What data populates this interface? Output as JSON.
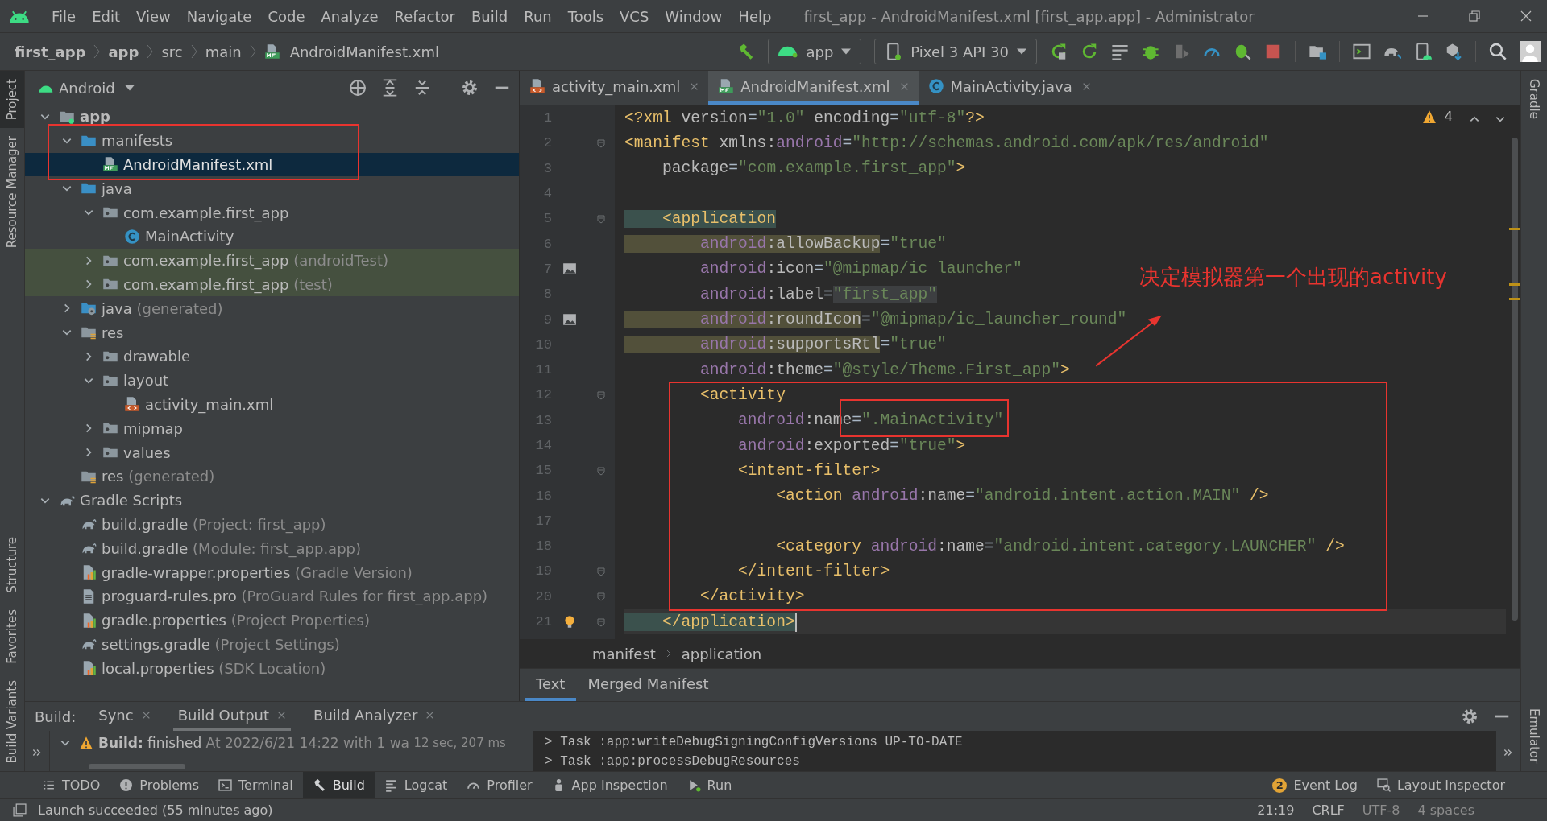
{
  "window": {
    "title": "first_app - AndroidManifest.xml [first_app.app] - Administrator"
  },
  "menu": [
    "File",
    "Edit",
    "View",
    "Navigate",
    "Code",
    "Analyze",
    "Refactor",
    "Build",
    "Run",
    "Tools",
    "VCS",
    "Window",
    "Help"
  ],
  "breadcrumb": [
    {
      "label": "first_app",
      "kind": "module"
    },
    {
      "label": "app",
      "kind": "module"
    },
    {
      "label": "src",
      "kind": "folder"
    },
    {
      "label": "main",
      "kind": "folder"
    },
    {
      "label": "AndroidManifest.xml",
      "kind": "manifest"
    }
  ],
  "run_config": {
    "module": "app",
    "device": "Pixel 3 API 30"
  },
  "left_tools": [
    {
      "label": "Project",
      "selected": true
    },
    {
      "label": "Resource Manager",
      "selected": false
    },
    {
      "label": "Structure",
      "selected": false
    },
    {
      "label": "Favorites",
      "selected": false
    },
    {
      "label": "Build Variants",
      "selected": false
    }
  ],
  "right_tools": [
    {
      "label": "Gradle",
      "selected": false
    },
    {
      "label": "Emulator",
      "selected": false
    }
  ],
  "project_panel": {
    "view": "Android",
    "tree": [
      {
        "label": "app",
        "kind": "module",
        "expanded": true,
        "selected": false,
        "tinted": false,
        "children": [
          {
            "label": "manifests",
            "kind": "folder",
            "expanded": true,
            "selected": false,
            "tinted": false,
            "children": [
              {
                "label": "AndroidManifest.xml",
                "kind": "manifest",
                "selected": true,
                "tinted": false
              }
            ]
          },
          {
            "label": "java",
            "kind": "folder",
            "expanded": true,
            "selected": false,
            "tinted": false,
            "children": [
              {
                "label": "com.example.first_app",
                "kind": "package",
                "expanded": true,
                "selected": false,
                "tinted": false,
                "children": [
                  {
                    "label": "MainActivity",
                    "kind": "class",
                    "selected": false,
                    "tinted": false
                  }
                ]
              },
              {
                "label": "com.example.first_app",
                "note": "(androidTest)",
                "kind": "package",
                "expanded": false,
                "selected": false,
                "tinted": true
              },
              {
                "label": "com.example.first_app",
                "note": "(test)",
                "kind": "package",
                "expanded": false,
                "selected": false,
                "tinted": true
              }
            ]
          },
          {
            "label": "java",
            "note": "(generated)",
            "kind": "generated",
            "expanded": false,
            "selected": false,
            "tinted": false
          },
          {
            "label": "res",
            "kind": "res",
            "expanded": true,
            "selected": false,
            "tinted": false,
            "children": [
              {
                "label": "drawable",
                "kind": "package",
                "expanded": false,
                "selected": false,
                "tinted": false
              },
              {
                "label": "layout",
                "kind": "package",
                "expanded": true,
                "selected": false,
                "tinted": false,
                "children": [
                  {
                    "label": "activity_main.xml",
                    "kind": "layout",
                    "selected": false,
                    "tinted": false
                  }
                ]
              },
              {
                "label": "mipmap",
                "kind": "package",
                "expanded": false,
                "selected": false,
                "tinted": false
              },
              {
                "label": "values",
                "kind": "package",
                "expanded": false,
                "selected": false,
                "tinted": false
              }
            ]
          },
          {
            "label": "res",
            "note": "(generated)",
            "kind": "res",
            "selected": false,
            "tinted": false
          }
        ]
      },
      {
        "label": "Gradle Scripts",
        "kind": "gradle",
        "expanded": true,
        "selected": false,
        "tinted": false,
        "children": [
          {
            "label": "build.gradle",
            "note": "(Project: first_app)",
            "kind": "gradle",
            "selected": false,
            "tinted": false
          },
          {
            "label": "build.gradle",
            "note": "(Module: first_app.app)",
            "kind": "gradle",
            "selected": false,
            "tinted": false
          },
          {
            "label": "gradle-wrapper.properties",
            "note": "(Gradle Version)",
            "kind": "properties",
            "selected": false,
            "tinted": false
          },
          {
            "label": "proguard-rules.pro",
            "note": "(ProGuard Rules for first_app.app)",
            "kind": "text",
            "selected": false,
            "tinted": false
          },
          {
            "label": "gradle.properties",
            "note": "(Project Properties)",
            "kind": "properties",
            "selected": false,
            "tinted": false
          },
          {
            "label": "settings.gradle",
            "note": "(Project Settings)",
            "kind": "gradle",
            "selected": false,
            "tinted": false
          },
          {
            "label": "local.properties",
            "note": "(SDK Location)",
            "kind": "properties",
            "selected": false,
            "tinted": false
          }
        ]
      }
    ]
  },
  "editor": {
    "tabs": [
      {
        "label": "activity_main.xml",
        "kind": "layout",
        "selected": false
      },
      {
        "label": "AndroidManifest.xml",
        "kind": "manifest",
        "selected": true
      },
      {
        "label": "MainActivity.java",
        "kind": "class",
        "selected": false
      }
    ],
    "warnings": "4",
    "lines": [
      {
        "number": "1",
        "kind": "plain",
        "current": false,
        "segments": [
          {
            "text": "<?xml",
            "kind": "tag"
          },
          {
            "text": " version",
            "kind": "attr"
          },
          {
            "text": "=",
            "kind": "plain"
          },
          {
            "text": "\"1.0\"",
            "kind": "str"
          },
          {
            "text": " encoding",
            "kind": "attr"
          },
          {
            "text": "=",
            "kind": "plain"
          },
          {
            "text": "\"utf-8\"",
            "kind": "str"
          },
          {
            "text": "?>",
            "kind": "tag"
          }
        ]
      },
      {
        "number": "2",
        "kind": "fold",
        "current": false,
        "segments": [
          {
            "text": "<manifest",
            "kind": "tag"
          },
          {
            "text": " xmlns:",
            "kind": "attr"
          },
          {
            "text": "android",
            "kind": "ns"
          },
          {
            "text": "=",
            "kind": "plain"
          },
          {
            "text": "\"http://schemas.android.com/apk/res/android\"",
            "kind": "str"
          }
        ]
      },
      {
        "number": "3",
        "kind": "plain",
        "current": false,
        "segments": [
          {
            "text": "    package",
            "kind": "attr"
          },
          {
            "text": "=",
            "kind": "plain"
          },
          {
            "text": "\"com.example.first_app\"",
            "kind": "str"
          },
          {
            "text": ">",
            "kind": "tag"
          }
        ]
      },
      {
        "number": "4",
        "kind": "plain",
        "current": false
      },
      {
        "number": "5",
        "kind": "fold",
        "current": false,
        "segments": [
          {
            "text": "    <application",
            "kind": "tag",
            "marked": true
          }
        ]
      },
      {
        "number": "6",
        "kind": "plain",
        "current": false,
        "segments": [
          {
            "text": "        android",
            "kind": "ns",
            "marked": true
          },
          {
            "text": ":allowBackup",
            "kind": "attr",
            "marked": true
          },
          {
            "text": "=",
            "kind": "plain"
          },
          {
            "text": "\"true\"",
            "kind": "str"
          }
        ]
      },
      {
        "number": "7",
        "kind": "image",
        "current": false,
        "segments": [
          {
            "text": "        android",
            "kind": "ns"
          },
          {
            "text": ":icon",
            "kind": "attr"
          },
          {
            "text": "=",
            "kind": "plain"
          },
          {
            "text": "\"@mipmap/ic_launcher\"",
            "kind": "str"
          }
        ]
      },
      {
        "number": "8",
        "kind": "plain",
        "current": false,
        "segments": [
          {
            "text": "        android",
            "kind": "ns"
          },
          {
            "text": ":label",
            "kind": "attr"
          },
          {
            "text": "=",
            "kind": "plain"
          },
          {
            "text": "\"first_app\"",
            "kind": "str",
            "marked": true
          }
        ]
      },
      {
        "number": "9",
        "kind": "image",
        "current": false,
        "segments": [
          {
            "text": "        android",
            "kind": "ns",
            "marked": true
          },
          {
            "text": ":roundIcon",
            "kind": "attr",
            "marked": true
          },
          {
            "text": "=",
            "kind": "plain"
          },
          {
            "text": "\"@mipmap/ic_launcher_round\"",
            "kind": "str"
          }
        ]
      },
      {
        "number": "10",
        "kind": "plain",
        "current": false,
        "segments": [
          {
            "text": "        android",
            "kind": "ns",
            "marked": true
          },
          {
            "text": ":supportsRtl",
            "kind": "attr",
            "marked": true
          },
          {
            "text": "=",
            "kind": "plain"
          },
          {
            "text": "\"true\"",
            "kind": "str"
          }
        ]
      },
      {
        "number": "11",
        "kind": "plain",
        "current": false,
        "segments": [
          {
            "text": "        android",
            "kind": "ns"
          },
          {
            "text": ":theme",
            "kind": "attr"
          },
          {
            "text": "=",
            "kind": "plain"
          },
          {
            "text": "\"@style/Theme.First_app\"",
            "kind": "str"
          },
          {
            "text": ">",
            "kind": "tag"
          }
        ]
      },
      {
        "number": "12",
        "kind": "fold",
        "current": false,
        "segments": [
          {
            "text": "        <activity",
            "kind": "tag"
          }
        ]
      },
      {
        "number": "13",
        "kind": "plain",
        "current": false,
        "segments": [
          {
            "text": "            android",
            "kind": "ns"
          },
          {
            "text": ":name",
            "kind": "attr"
          },
          {
            "text": "=",
            "kind": "plain"
          },
          {
            "text": "\".MainActivity\"",
            "kind": "str"
          }
        ]
      },
      {
        "number": "14",
        "kind": "plain",
        "current": false,
        "segments": [
          {
            "text": "            android",
            "kind": "ns"
          },
          {
            "text": ":exported",
            "kind": "attr"
          },
          {
            "text": "=",
            "kind": "plain"
          },
          {
            "text": "\"true\"",
            "kind": "str"
          },
          {
            "text": ">",
            "kind": "tag"
          }
        ]
      },
      {
        "number": "15",
        "kind": "fold",
        "current": false,
        "segments": [
          {
            "text": "            <intent-filter>",
            "kind": "tag"
          }
        ]
      },
      {
        "number": "16",
        "kind": "plain",
        "current": false,
        "segments": [
          {
            "text": "                <action",
            "kind": "tag"
          },
          {
            "text": " android",
            "kind": "ns"
          },
          {
            "text": ":name",
            "kind": "attr"
          },
          {
            "text": "=",
            "kind": "plain"
          },
          {
            "text": "\"android.intent.action.MAIN\"",
            "kind": "str"
          },
          {
            "text": " />",
            "kind": "tag"
          }
        ]
      },
      {
        "number": "17",
        "kind": "plain",
        "current": false
      },
      {
        "number": "18",
        "kind": "plain",
        "current": false,
        "segments": [
          {
            "text": "                <category",
            "kind": "tag"
          },
          {
            "text": " android",
            "kind": "ns"
          },
          {
            "text": ":name",
            "kind": "attr"
          },
          {
            "text": "=",
            "kind": "plain"
          },
          {
            "text": "\"android.intent.category.LAUNCHER\"",
            "kind": "str"
          },
          {
            "text": " />",
            "kind": "tag"
          }
        ]
      },
      {
        "number": "19",
        "kind": "fold",
        "current": false,
        "segments": [
          {
            "text": "            </intent-filter>",
            "kind": "tag"
          }
        ]
      },
      {
        "number": "20",
        "kind": "fold",
        "current": false,
        "segments": [
          {
            "text": "        </activity>",
            "kind": "tag"
          }
        ]
      },
      {
        "number": "21",
        "kind": "bulb",
        "current": true,
        "segments": [
          {
            "text": "    </application>",
            "kind": "tag",
            "marked": true
          }
        ]
      }
    ],
    "path": [
      "manifest",
      "application"
    ],
    "bottom_tabs": [
      {
        "label": "Text",
        "selected": true
      },
      {
        "label": "Merged Manifest",
        "selected": false
      }
    ]
  },
  "build_panel": {
    "label": "Build:",
    "tabs": [
      {
        "label": "Sync",
        "selected": false
      },
      {
        "label": "Build Output",
        "selected": true
      },
      {
        "label": "Build Analyzer",
        "selected": false
      }
    ],
    "result": {
      "status": "Build:",
      "message": "finished",
      "detail": "At 2022/6/21 14:22 with 1 wa",
      "time": "12 sec, 207 ms",
      "expanded": true
    },
    "console": [
      "> Task :app:writeDebugSigningConfigVersions UP-TO-DATE",
      "> Task :app:processDebugResources"
    ]
  },
  "tool_windows": [
    {
      "label": "TODO",
      "kind": "list",
      "selected": false
    },
    {
      "label": "Problems",
      "kind": "problems",
      "selected": false
    },
    {
      "label": "Terminal",
      "kind": "terminal",
      "selected": false
    },
    {
      "label": "Build",
      "kind": "hammer",
      "selected": true
    },
    {
      "label": "Logcat",
      "kind": "logcat",
      "selected": false
    },
    {
      "label": "Profiler",
      "kind": "gauge",
      "selected": false
    },
    {
      "label": "App Inspection",
      "kind": "inspect",
      "selected": false
    },
    {
      "label": "Run",
      "kind": "run",
      "selected": false
    }
  ],
  "tool_windows_right": [
    {
      "label": "Event Log",
      "badge": "2"
    },
    {
      "label": "Layout Inspector"
    }
  ],
  "status_bar": {
    "message": "Launch succeeded (55 minutes ago)",
    "items": [
      "21:19",
      "CRLF",
      "UTF-8",
      "4 spaces"
    ]
  },
  "annotation": {
    "text": "决定模拟器第一个出现的activity"
  }
}
